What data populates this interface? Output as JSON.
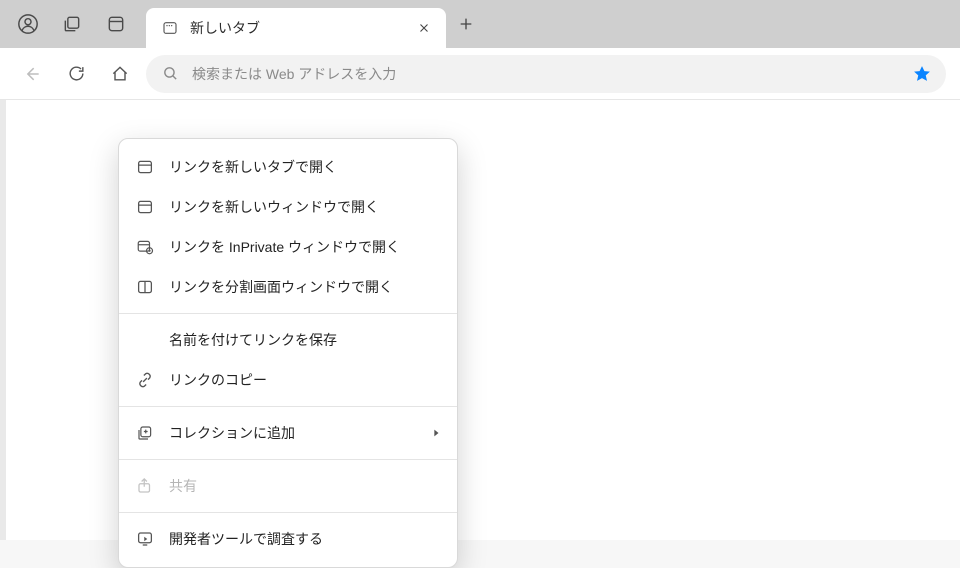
{
  "tab": {
    "title": "新しいタブ"
  },
  "address": {
    "placeholder": "検索または Web アドレスを入力"
  },
  "context_menu": {
    "open_new_tab": "リンクを新しいタブで開く",
    "open_new_window": "リンクを新しいウィンドウで開く",
    "open_inprivate": "リンクを InPrivate ウィンドウで開く",
    "open_split": "リンクを分割画面ウィンドウで開く",
    "save_link_as": "名前を付けてリンクを保存",
    "copy_link": "リンクのコピー",
    "add_to_collections": "コレクションに追加",
    "share": "共有",
    "inspect": "開発者ツールで調査する"
  }
}
